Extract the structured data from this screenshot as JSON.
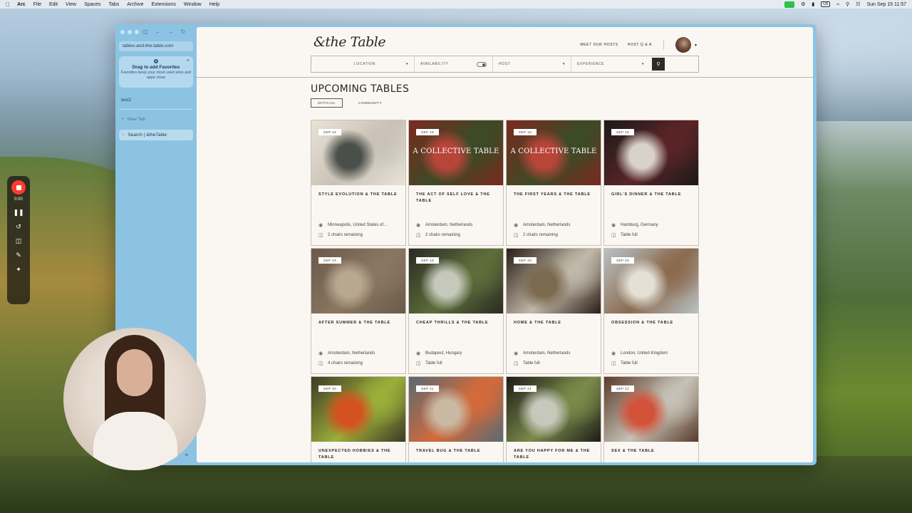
{
  "menubar": {
    "app": "Arc",
    "items": [
      "File",
      "Edit",
      "View",
      "Spaces",
      "Tabs",
      "Archive",
      "Extensions",
      "Window",
      "Help"
    ],
    "kbd": "US",
    "datetime": "Sun Sep 15  11:57"
  },
  "sidebar": {
    "url": "tables.and-the-table.com",
    "favorites_title": "Drag to add Favorites",
    "favorites_sub": "Favorites keep your most used sites and apps close",
    "space_name": "test2",
    "new_tab": "New Tab",
    "active_tab": "Search | &theTable"
  },
  "recorder": {
    "time": "0:00"
  },
  "site": {
    "logo": "&the Table",
    "nav": [
      "MEET OUR HOSTS",
      "HOST Q & A"
    ],
    "filters": {
      "location": "LOCATION",
      "availability": "AVAILABILITY",
      "host": "HOST",
      "experience": "EXPERIENCE"
    },
    "title": "UPCOMING TABLES",
    "tabs": [
      "OFFICIAL",
      "COMMUNITY"
    ],
    "cards": [
      {
        "date": "SEP 16",
        "title": "STYLE EVOLUTION & THE TABLE",
        "location": "Minneapolis, United States of...",
        "seats": "2 chairs remaining",
        "overlay": "",
        "palette": [
          "#e9e2d6",
          "#4b4f4a",
          "#c9c2b6"
        ]
      },
      {
        "date": "SEP 18",
        "title": "THE ACT OF SELF LOVE & THE TABLE",
        "location": "Amsterdam, Netherlands",
        "seats": "2 chairs remaining",
        "overlay": "A COLLECTIVE TABLE",
        "palette": [
          "#7a2a1f",
          "#b8453a",
          "#3c4a26"
        ]
      },
      {
        "date": "SEP 18",
        "title": "THE FIRST YEARS & THE TABLE",
        "location": "Amsterdam, Netherlands",
        "seats": "2 chairs remaining",
        "overlay": "A COLLECTIVE TABLE",
        "palette": [
          "#7a2a1f",
          "#b8453a",
          "#3c4a26"
        ]
      },
      {
        "date": "SEP 18",
        "title": "GIRL'S DINNER  & THE TABLE",
        "location": "Hamburg, Germany",
        "seats": "Table full",
        "overlay": "",
        "palette": [
          "#1c1a1a",
          "#d9d2cc",
          "#5a2426"
        ]
      },
      {
        "date": "SEP 19",
        "title": "AFTER SUMMER & THE TABLE",
        "location": "Amsterdam, Netherlands",
        "seats": "4 chairs remaining",
        "overlay": "",
        "palette": [
          "#6a5a4a",
          "#b9a891",
          "#8a7661"
        ]
      },
      {
        "date": "SEP 19",
        "title": "CHEAP THRILLS & THE TABLE",
        "location": "Budapest, Hungary",
        "seats": "Table full",
        "overlay": "",
        "palette": [
          "#2b2a22",
          "#c5c8bb",
          "#5d6e3a"
        ]
      },
      {
        "date": "SEP 20",
        "title": "HOME & THE TABLE",
        "location": "Amsterdam, Netherlands",
        "seats": "Table full",
        "overlay": "",
        "palette": [
          "#2a1e16",
          "#7a6a4f",
          "#c0b8a9"
        ]
      },
      {
        "date": "SEP 20",
        "title": "OBSESSION & THE TABLE",
        "location": "London, United Kingdom",
        "seats": "Table full",
        "overlay": "",
        "palette": [
          "#b9c2c6",
          "#e5e0d6",
          "#8b6b4f"
        ]
      },
      {
        "date": "SEP 20",
        "title": "UNEXPECTED HOBBIES & THE TABLE",
        "location": "",
        "seats": "",
        "overlay": "",
        "palette": [
          "#3d3a24",
          "#d3521f",
          "#9aaf3a"
        ]
      },
      {
        "date": "SEP 21",
        "title": "TRAVEL BUG & THE TABLE",
        "location": "",
        "seats": "",
        "overlay": "",
        "palette": [
          "#5a6a72",
          "#c9b9a3",
          "#d36a3a"
        ]
      },
      {
        "date": "SEP 21",
        "title": "ARE YOU HAPPY FOR ME & THE TABLE",
        "location": "",
        "seats": "",
        "overlay": "",
        "palette": [
          "#1e1c18",
          "#c5c8bb",
          "#7a8a4a"
        ]
      },
      {
        "date": "SEP 22",
        "title": "SEX & THE TABLE",
        "location": "",
        "seats": "",
        "overlay": "",
        "palette": [
          "#5a3a2a",
          "#d3523a",
          "#c5c2b5"
        ]
      }
    ]
  }
}
